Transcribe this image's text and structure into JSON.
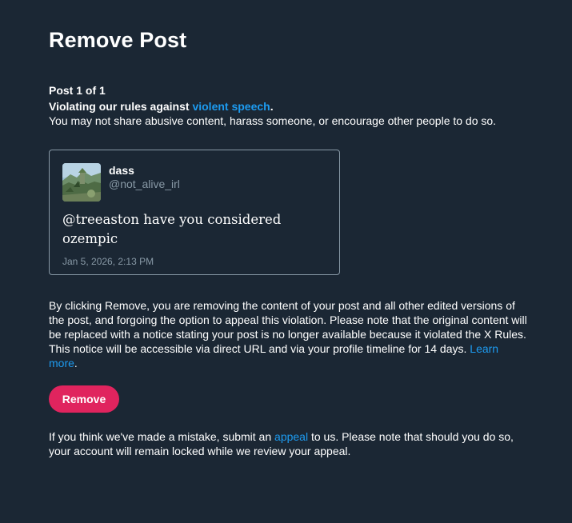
{
  "page": {
    "title": "Remove Post"
  },
  "violation": {
    "counter": "Post 1 of 1",
    "prefix": "Violating our rules against ",
    "rule_link": "violent speech",
    "suffix": ".",
    "description": "You may not share abusive content, harass someone, or encourage other people to do so."
  },
  "post": {
    "display_name": "dass",
    "handle": "@not_alive_irl",
    "text": "@treeaston have you considered ozempic",
    "timestamp": "Jan 5, 2026, 2:13 PM",
    "avatar_icon": "landscape-photo-avatar"
  },
  "notice": {
    "text": "By clicking Remove, you are removing the content of your post and all other edited versions of the post, and forgoing the option to appeal this violation. Please note that the original content will be replaced with a notice stating your post is no longer available because it violated the X Rules. This notice will be accessible via direct URL and via your profile timeline for 14 days. ",
    "learn_more": "Learn more",
    "end": "."
  },
  "actions": {
    "remove_label": "Remove"
  },
  "appeal": {
    "prefix": "If you think we've made a mistake, submit an ",
    "link": "appeal",
    "suffix": " to us. Please note that should you do so, your account will remain locked while we review your appeal."
  },
  "colors": {
    "background": "#1b2734",
    "link": "#1d9bf0",
    "danger": "#e0245e",
    "muted": "#8899a6"
  }
}
